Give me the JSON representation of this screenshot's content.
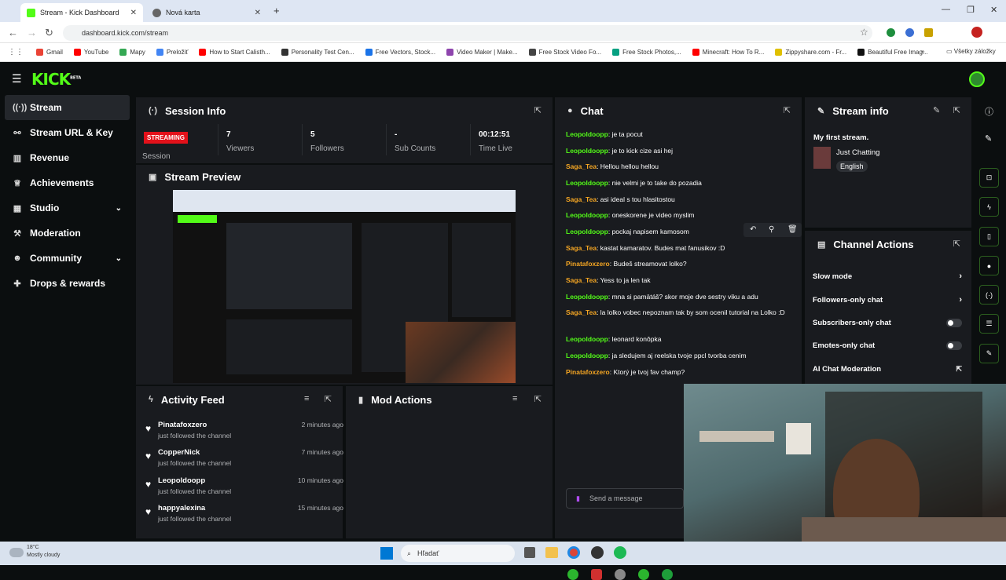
{
  "browser": {
    "tabs": [
      {
        "label": "Stream - Kick Dashboard",
        "active": true
      },
      {
        "label": "Nová karta",
        "active": false
      }
    ],
    "url": "dashboard.kick.com/stream",
    "bookmarks": [
      "Gmail",
      "YouTube",
      "Mapy",
      "Preložiť",
      "How to Start Calisth...",
      "Personality Test Cen...",
      "Free Vectors, Stock...",
      "Video Maker | Make...",
      "Free Stock Video Fo...",
      "Free Stock Photos,...",
      "Minecraft: How To R...",
      "Zippyshare.com - Fr...",
      "Beautiful Free Imag..."
    ],
    "all_bookmarks": "Všetky záložky"
  },
  "app": {
    "logo": "KICK",
    "logo_badge": "BETA",
    "accent": "#53fc18"
  },
  "sidebar": {
    "items": [
      {
        "label": "Stream",
        "icon": "broadcast-icon",
        "active": true
      },
      {
        "label": "Stream URL & Key",
        "icon": "link-icon"
      },
      {
        "label": "Revenue",
        "icon": "revenue-icon"
      },
      {
        "label": "Achievements",
        "icon": "trophy-icon"
      },
      {
        "label": "Studio",
        "icon": "studio-icon",
        "expandable": true
      },
      {
        "label": "Moderation",
        "icon": "gavel-icon"
      },
      {
        "label": "Community",
        "icon": "community-icon",
        "expandable": true
      },
      {
        "label": "Drops & rewards",
        "icon": "gift-icon"
      }
    ]
  },
  "session": {
    "title": "Session Info",
    "status_badge": "STREAMING",
    "session_label": "Session",
    "stats": [
      {
        "value": "7",
        "label": "Viewers"
      },
      {
        "value": "5",
        "label": "Followers"
      },
      {
        "value": "-",
        "label": "Sub Counts"
      },
      {
        "value": "00:12:51",
        "label": "Time Live"
      }
    ]
  },
  "preview": {
    "title": "Stream Preview"
  },
  "activity": {
    "title": "Activity Feed",
    "items": [
      {
        "name": "Pinatafoxzero",
        "message": "just followed the channel",
        "time": "2 minutes ago"
      },
      {
        "name": "CopperNick",
        "message": "just followed the channel",
        "time": "7 minutes ago"
      },
      {
        "name": "Leopoldoopp",
        "message": "just followed the channel",
        "time": "10 minutes ago"
      },
      {
        "name": "happyalexina",
        "message": "just followed the channel",
        "time": "15 minutes ago"
      }
    ]
  },
  "mod_actions": {
    "title": "Mod Actions"
  },
  "chat": {
    "title": "Chat",
    "messages": [
      {
        "user": "Leopoldoopp",
        "color": "#53fc18",
        "text": "je ta pocut"
      },
      {
        "user": "Leopoldoopp",
        "color": "#53fc18",
        "text": "je to kick cize asi hej"
      },
      {
        "user": "Saga_Tea",
        "color": "#f5a623",
        "text": "Hellou hellou hellou"
      },
      {
        "user": "Leopoldoopp",
        "color": "#53fc18",
        "text": "nie velmi je to take do pozadia"
      },
      {
        "user": "Saga_Tea",
        "color": "#f5a623",
        "text": "asi ideal s tou hlasitostou"
      },
      {
        "user": "Leopoldoopp",
        "color": "#53fc18",
        "text": "oneskorene je video myslim"
      },
      {
        "user": "Leopoldoopp",
        "color": "#53fc18",
        "text": "pockaj napisem kamosom"
      },
      {
        "user": "Saga_Tea",
        "color": "#f5a623",
        "text": "kastat kamaratov. Budes mat fanusikov :D"
      },
      {
        "user": "Pinatafoxzero",
        "color": "#f5a623",
        "text": "Budeš streamovat lolko?"
      },
      {
        "user": "Saga_Tea",
        "color": "#f5a623",
        "text": "Yess to ja len tak"
      },
      {
        "user": "Leopoldoopp",
        "color": "#53fc18",
        "text": "mna si pamätáš? skor moje dve sestry viku a adu"
      },
      {
        "user": "Saga_Tea",
        "color": "#f5a623",
        "text": "la lolko vobec nepoznam tak by som ocenil tutorial na Lolko :D"
      },
      {
        "user": "Leopoldoopp",
        "color": "#53fc18",
        "text": "leonard konôpka"
      },
      {
        "user": "Leopoldoopp",
        "color": "#53fc18",
        "text": "ja sledujem aj reelska tvoje ppcl tvorba cenim"
      },
      {
        "user": "Pinatafoxzero",
        "color": "#f5a623",
        "text": "Ktorý je tvoj fav champ?"
      }
    ],
    "input_placeholder": "Send a message"
  },
  "stream_info": {
    "title": "Stream info",
    "stream_title": "My first stream.",
    "category": "Just Chatting",
    "language": "English"
  },
  "channel_actions": {
    "title": "Channel Actions",
    "items": [
      {
        "label": "Slow mode",
        "control": "arrow"
      },
      {
        "label": "Followers-only chat",
        "control": "arrow"
      },
      {
        "label": "Subscribers-only chat",
        "control": "toggle"
      },
      {
        "label": "Emotes-only chat",
        "control": "toggle"
      },
      {
        "label": "AI Chat Moderation",
        "control": "external"
      }
    ]
  },
  "taskbar": {
    "weather_temp": "18°C",
    "weather_desc": "Mostly cloudy",
    "search_placeholder": "Hľadať"
  }
}
